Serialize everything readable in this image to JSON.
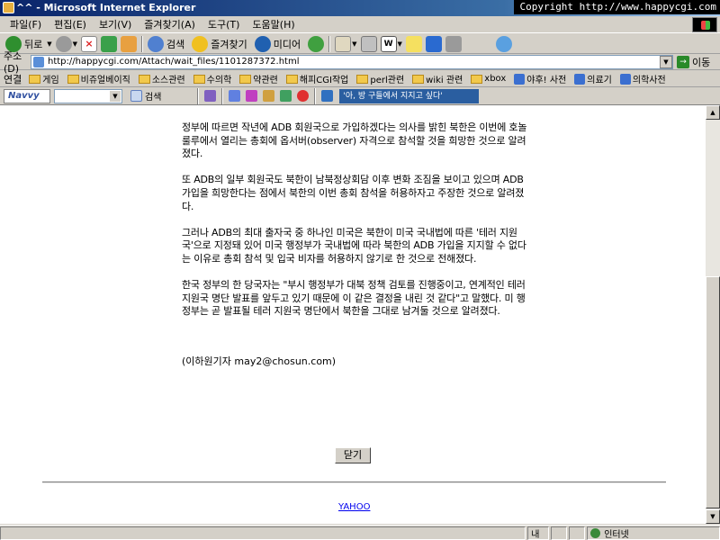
{
  "window": {
    "title": "^^ - Microsoft Internet Explorer",
    "copyright": "Copyright http://www.happycgi.com"
  },
  "menu": [
    "파일(F)",
    "편집(E)",
    "보기(V)",
    "즐겨찾기(A)",
    "도구(T)",
    "도움말(H)"
  ],
  "toolbar": {
    "back": "뒤로",
    "search": "검색",
    "favorites": "즐겨찾기",
    "media": "미디어"
  },
  "address": {
    "label": "주소(D)",
    "url": "http://happycgi.com/Attach/wait_files/1101287372.html",
    "go": "이동"
  },
  "links": {
    "label": "연결",
    "items": [
      "게임",
      "비쥬얼베이직",
      "소스관련",
      "수의학",
      "약관련",
      "해피CGI작업",
      "perl관련",
      "wiki 관련",
      "xbox",
      "야후! 사전",
      "의료기",
      "의학사전"
    ]
  },
  "navvy": {
    "brand": "Navvy",
    "search": "검색",
    "phrase": "'아, 방 구들에서 지지고 싶다'"
  },
  "article": {
    "paragraphs": [
      "정부에 따르면 작년에 ADB 회원국으로 가입하겠다는 의사를 밝힌 북한은 이번에 호놀룰루에서 열리는 총회에 옵서버(observer) 자격으로 참석할 것을 희망한 것으로 알려졌다.",
      "또 ADB의 일부 회원국도 북한이 남북정상회담 이후 변화 조짐을 보이고 있으며 ADB가입을 희망한다는 점에서 북한의 이번 총회 참석을 허용하자고 주장한 것으로 알려졌다.",
      "그러나 ADB의 최대 출자국 중 하나인 미국은 북한이 미국 국내법에 따른 '테러 지원국'으로 지정돼 있어 미국 행정부가 국내법에 따라 북한의 ADB 가입을 지지할 수 없다는 이유로 총회 참석 및 입국 비자를 허용하지 않기로 한 것으로 전해졌다.",
      "한국 정부의 한 당국자는 \"부시 행정부가 대북 정책 검토를 진행중이고, 연계적인 테러 지원국 명단 발표를 앞두고 있기 때문에 이 같은 결정을 내린 것 같다\"고 말했다. 미 행정부는 곧 발표될 테러 지원국 명단에서 북한을 그대로 남겨둘 것으로 알려졌다."
    ],
    "byline": "(이하원기자 may2@chosun.com)"
  },
  "close_button": "닫기",
  "footer_link": "YAHOO",
  "status": {
    "page": "내",
    "zone": "인터넷"
  }
}
